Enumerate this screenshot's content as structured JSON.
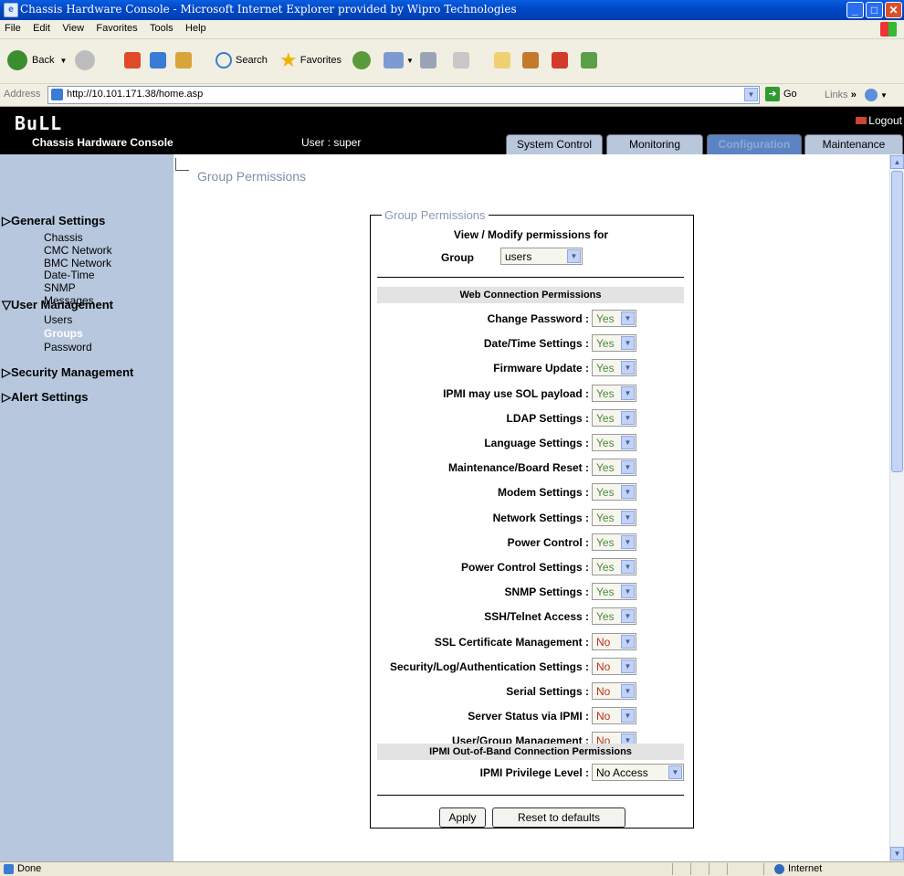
{
  "window": {
    "title": "Chassis Hardware Console - Microsoft Internet Explorer provided by Wipro Technologies"
  },
  "menu": [
    "File",
    "Edit",
    "View",
    "Favorites",
    "Tools",
    "Help"
  ],
  "toolbar": {
    "back": "Back",
    "search": "Search",
    "favorites": "Favorites"
  },
  "address": {
    "label": "Address",
    "url": "http://10.101.171.38/home.asp",
    "go": "Go",
    "links": "Links"
  },
  "app": {
    "logo": "BuLL",
    "title": "Chassis Hardware Console",
    "user": "User : super",
    "logout": "Logout",
    "tabs": [
      {
        "label": "System Control",
        "active": false
      },
      {
        "label": "Monitoring",
        "active": false
      },
      {
        "label": "Configuration",
        "active": true
      },
      {
        "label": "Maintenance",
        "active": false
      }
    ]
  },
  "sidebar": {
    "sections": [
      {
        "label": "General Settings",
        "expanded": false,
        "items": [
          "Chassis",
          "CMC Network",
          "BMC Network",
          "Date-Time",
          "SNMP",
          "Messages"
        ]
      },
      {
        "label": "User Management",
        "expanded": true,
        "items": [
          "Users",
          "Groups",
          "Password"
        ],
        "selected": "Groups"
      },
      {
        "label": "Security Management",
        "expanded": false,
        "items": []
      },
      {
        "label": "Alert Settings",
        "expanded": false,
        "items": []
      }
    ]
  },
  "page": {
    "title": "Group Permissions",
    "legend": "Group Permissions",
    "view_title": "View / Modify permissions for",
    "group_label": "Group",
    "group_value": "users",
    "web_section": "Web Connection Permissions",
    "permissions": [
      {
        "label": "Change Password :",
        "value": "Yes"
      },
      {
        "label": "Date/Time Settings :",
        "value": "Yes"
      },
      {
        "label": "Firmware Update :",
        "value": "Yes"
      },
      {
        "label": "IPMI may use SOL payload :",
        "value": "Yes"
      },
      {
        "label": "LDAP Settings :",
        "value": "Yes"
      },
      {
        "label": "Language Settings :",
        "value": "Yes"
      },
      {
        "label": "Maintenance/Board Reset :",
        "value": "Yes"
      },
      {
        "label": "Modem Settings :",
        "value": "Yes"
      },
      {
        "label": "Network Settings :",
        "value": "Yes"
      },
      {
        "label": "Power Control :",
        "value": "Yes"
      },
      {
        "label": "Power Control Settings :",
        "value": "Yes"
      },
      {
        "label": "SNMP Settings :",
        "value": "Yes"
      },
      {
        "label": "SSH/Telnet Access :",
        "value": "Yes"
      },
      {
        "label": "SSL Certificate Management :",
        "value": "No"
      },
      {
        "label": "Security/Log/Authentication Settings :",
        "value": "No"
      },
      {
        "label": "Serial Settings :",
        "value": "No"
      },
      {
        "label": "Server Status via IPMI :",
        "value": "No"
      },
      {
        "label": "User/Group Management :",
        "value": "No"
      }
    ],
    "ipmi_section": "IPMI Out-of-Band Connection Permissions",
    "ipmi_label": "IPMI Privilege Level :",
    "ipmi_value": "No Access",
    "apply": "Apply",
    "reset": "Reset to defaults"
  },
  "status": {
    "text": "Done",
    "zone": "Internet"
  },
  "colors": {
    "yes": "#4d8a3a",
    "no": "#c0301c",
    "sidebar_bg": "#b7c8de",
    "tab_active": "#5c84c4"
  }
}
